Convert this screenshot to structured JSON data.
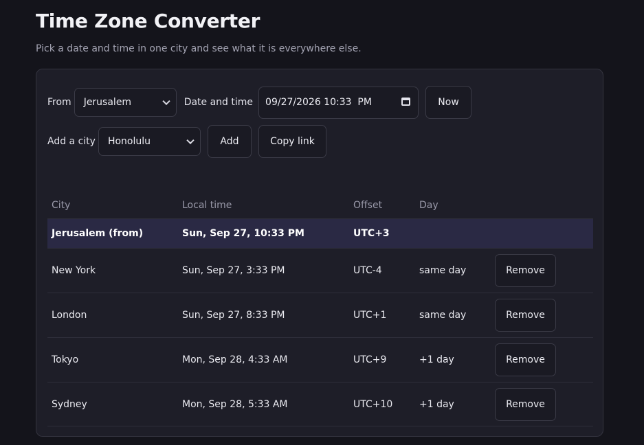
{
  "header": {
    "title": "Time Zone Converter",
    "subtitle": "Pick a date and time in one city and see what it is everywhere else."
  },
  "controls": {
    "from_label": "From",
    "from_value": "Jerusalem",
    "datetime_label": "Date and time",
    "datetime_value": "09/27/2026 10:33  PM",
    "now_label": "Now",
    "add_city_label": "Add a city",
    "add_city_value": "Honolulu",
    "add_label": "Add",
    "copy_link_label": "Copy link"
  },
  "table": {
    "columns": [
      "City",
      "Local time",
      "Offset",
      "Day"
    ],
    "from_row": {
      "city": "Jerusalem (from)",
      "local_time": "Sun, Sep 27, 10:33 PM",
      "offset": "UTC+3",
      "day": ""
    },
    "rows": [
      {
        "city": "New York",
        "local_time": "Sun, Sep 27, 3:33 PM",
        "offset": "UTC-4",
        "day": "same day",
        "action": "Remove"
      },
      {
        "city": "London",
        "local_time": "Sun, Sep 27, 8:33 PM",
        "offset": "UTC+1",
        "day": "same day",
        "action": "Remove"
      },
      {
        "city": "Tokyo",
        "local_time": "Mon, Sep 28, 4:33 AM",
        "offset": "UTC+9",
        "day": "+1 day",
        "action": "Remove"
      },
      {
        "city": "Sydney",
        "local_time": "Mon, Sep 28, 5:33 AM",
        "offset": "UTC+10",
        "day": "+1 day",
        "action": "Remove"
      }
    ]
  },
  "icons": {
    "from_select": "chevron-down-icon",
    "add_select": "chevron-down-icon",
    "datetime": "calendar-icon"
  },
  "colors": {
    "background": "#14141b",
    "card": "#1e1e28",
    "highlight_row": "#2a2944",
    "muted_text": "#9a9aaa"
  }
}
